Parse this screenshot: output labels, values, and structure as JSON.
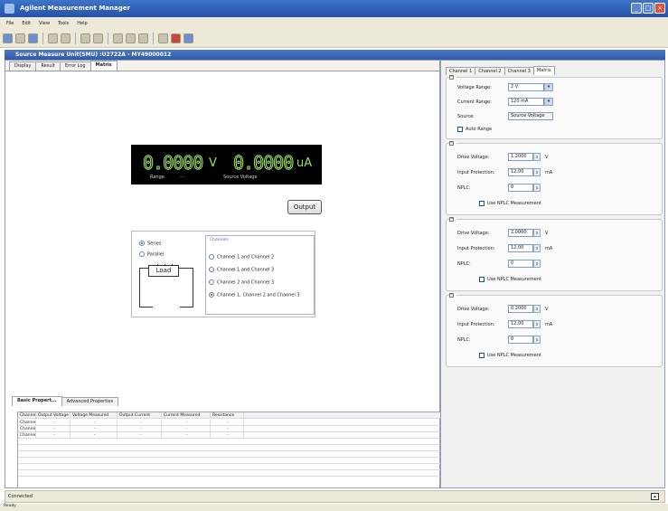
{
  "window": {
    "title": "Agilent Measurement Manager"
  },
  "menu": [
    "File",
    "Edit",
    "View",
    "Tools",
    "Help"
  ],
  "subwindow": {
    "title": "Source Measure Unit(SMU) :U2722A - MY49000012"
  },
  "left_tabs": [
    {
      "label": "Display"
    },
    {
      "label": "Result"
    },
    {
      "label": "Error Log"
    },
    {
      "label": "Matrix",
      "active": true
    }
  ],
  "display": {
    "voltage": "0.0000",
    "voltage_unit": "V",
    "current": "0.0000",
    "current_unit": "uA",
    "range_label": "Range",
    "range_value": "-    -",
    "source_label": "Source Voltage"
  },
  "output_button": "Output",
  "wiring": {
    "modes": [
      {
        "label": "Series",
        "selected": true
      },
      {
        "label": "Parallel",
        "selected": false
      }
    ],
    "load_label": "Load",
    "channels_title": "Channels",
    "channels": [
      {
        "label": "Channel 1 and Channel 2",
        "selected": false
      },
      {
        "label": "Channel 1 and Channel 3",
        "selected": false
      },
      {
        "label": "Channel 2 and Channel 3",
        "selected": false
      },
      {
        "label": "Channel 1, Channel 2 and Channel 3",
        "selected": true
      }
    ]
  },
  "bottom_tabs": [
    {
      "label": "Basic Propert...",
      "active": true
    },
    {
      "label": "Advanced Properties"
    }
  ],
  "grid": {
    "columns": [
      "Channel",
      "Output Voltage",
      "Voltage Measured",
      "Output Current",
      "Current Measured",
      "Resistance"
    ],
    "rows": [
      [
        "Channe...",
        "-",
        "-",
        "-",
        "-",
        "-"
      ],
      [
        "Channe...",
        "-",
        "-",
        "-",
        "-",
        "-"
      ],
      [
        "Channe...",
        "-",
        "-",
        "-",
        "-",
        "-"
      ]
    ]
  },
  "right_tabs": [
    {
      "label": "Channel 1"
    },
    {
      "label": "Channel 2"
    },
    {
      "label": "Channel 3"
    },
    {
      "label": "Matrix",
      "active": true
    }
  ],
  "general": {
    "voltage_range_label": "Voltage Range:",
    "voltage_range_value": "2 V",
    "current_range_label": "Current Range:",
    "current_range_value": "120 mA",
    "source_label": "Source:",
    "source_value": "Source Voltage",
    "auto_range_label": "Auto Range"
  },
  "channel_groups": [
    {
      "drive_label": "Drive Voltage:",
      "drive_value": "1.2000",
      "drive_unit": "V",
      "protection_label": "Input Protection:",
      "protection_value": "12.00",
      "protection_unit": "mA",
      "nplc_label": "NPLC:",
      "nplc_value": "0",
      "use_nplc_label": "Use NPLC Measurement"
    },
    {
      "drive_label": "Drive Voltage:",
      "drive_value": "2.0000",
      "drive_unit": "V",
      "protection_label": "Input Protection:",
      "protection_value": "12.00",
      "protection_unit": "mA",
      "nplc_label": "NPLC:",
      "nplc_value": "0",
      "use_nplc_label": "Use NPLC Measurement"
    },
    {
      "drive_label": "Drive Voltage:",
      "drive_value": "0.2000",
      "drive_unit": "V",
      "protection_label": "Input Protection:",
      "protection_value": "12.00",
      "protection_unit": "mA",
      "nplc_label": "NPLC:",
      "nplc_value": "0",
      "use_nplc_label": "Use NPLC Measurement"
    }
  ],
  "status": {
    "text": "Connected"
  },
  "bottom_status": {
    "text": "Ready"
  }
}
